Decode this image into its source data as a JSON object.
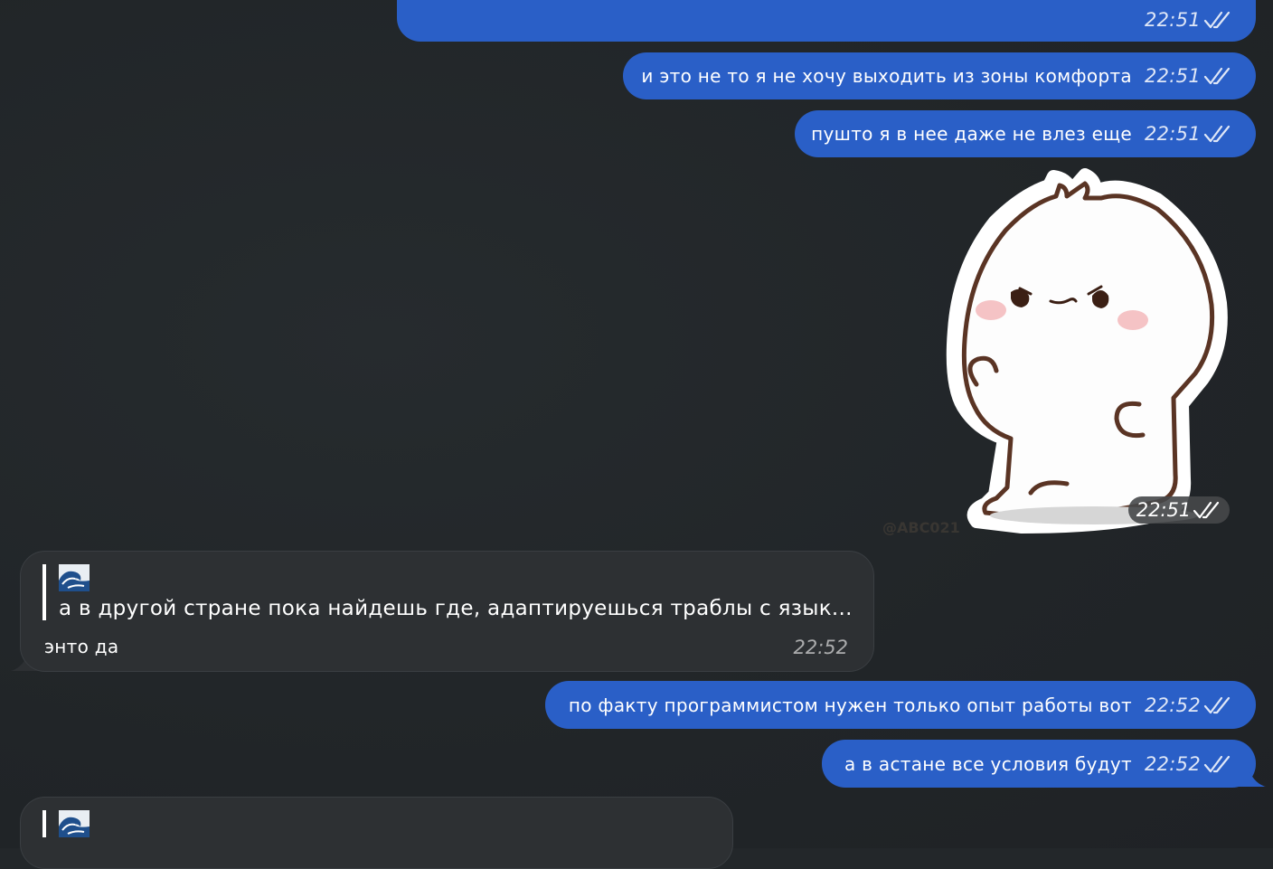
{
  "messages": {
    "m1": {
      "time": "22:51"
    },
    "m2": {
      "text": "и это не то я не хочу выходить из зоны комфорта",
      "time": "22:51"
    },
    "m3": {
      "text": "пушто я в нее даже не влез еще",
      "time": "22:51"
    },
    "sticker": {
      "time": "22:51",
      "watermark": "@ABC021"
    },
    "m4": {
      "quote_emoji": "wave-emoji",
      "quote_text": "а в другой стране пока найдешь где, адаптируешься траблы с язык...",
      "text": "энто да",
      "time": "22:52"
    },
    "m5": {
      "text": "по факту программистом нужен только опыт работы вот",
      "time": "22:52"
    },
    "m6": {
      "text": "а в астане все условия будут",
      "time": "22:52"
    },
    "m7": {
      "quote_emoji": "wave-emoji"
    }
  },
  "colors": {
    "background": "#23272a",
    "outgoing_bubble": "#2a5fc7",
    "incoming_bubble": "#2d3033"
  },
  "icons": {
    "read_receipt": "double-check-icon"
  }
}
